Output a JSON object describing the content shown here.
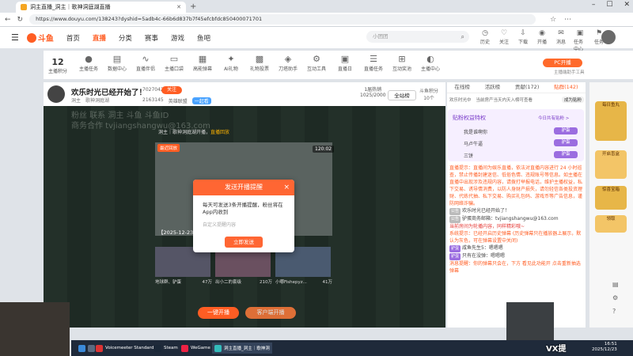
{
  "browser": {
    "tab_title": "洞主直播_洞主｜歌神洞庭湖直播",
    "url": "https://www.douyu.com/138243?dyshid=5adb4c-66b6d837b7f45efcbfdc850400071701"
  },
  "site": {
    "logo_text": "斗鱼",
    "nav": [
      "首页",
      "直播",
      "分类",
      "赛事",
      "游戏",
      "鱼吧"
    ],
    "search_placeholder": "小团团",
    "header_icons": [
      "历史",
      "关注",
      "下载",
      "开播",
      "消息",
      "任务中心",
      "任务"
    ]
  },
  "toolbar": {
    "level_value": "12",
    "level_label": "主播积分",
    "items": [
      "主播任务",
      "数据中心",
      "直播伴侣",
      "主播口袋",
      "高能弹幕",
      "AI礼物",
      "礼物投票",
      "刀塔助手",
      "互动工具",
      "直播日",
      "直播任务",
      "互动奖池",
      "主播中心"
    ],
    "pc_button": "PC开播",
    "pc_sub": "主播端助手工具"
  },
  "room": {
    "title": "欢乐时光已经开始了！",
    "fans": "7027042",
    "follow": "关注",
    "anchor": "洞主",
    "category": "歌神洞庭湖",
    "hot": "2163145",
    "game": "英雄联盟",
    "badge": "一起看",
    "rank_label": "1届热销",
    "rank_value": "1025/2000",
    "all_site": "全站榜",
    "fish_label": "斗鱼积分",
    "fish_value": "10个"
  },
  "video": {
    "watermark_line1": "粉丝 联系 洞主 斗鱼 斗鱼ID",
    "watermark_line2": "商务合作 tvjiangshangwu@163.com",
    "notice_prefix": "洞主｜歌神洞庭湖开播，",
    "notice_highlight": "直播回放",
    "preview_tag": "最近回放",
    "preview_time": "120:02",
    "preview_date": "【2025-12-23 0...",
    "thumbs": [
      {
        "title": "地球群、驴蛋",
        "count": "47万"
      },
      {
        "title": "出小二的套级",
        "count": "210万"
      },
      {
        "title": "小哪Fishepyz...",
        "count": "41万"
      }
    ],
    "open_live": "一键开播",
    "open_live2": "客户端开播"
  },
  "modal": {
    "title": "发送开播提醒",
    "body": "每天可发送3条开播提醒，粉丝将在App内收到",
    "input_placeholder": "自定义提醒内容",
    "button": "立即发送",
    "close": "×"
  },
  "chat": {
    "tabs": [
      "在线榜",
      "活跃榜",
      "贡献(172)",
      "贴群(142)"
    ],
    "info": "欢乐时光中",
    "info_right": "当前房产当天内天入榜可查看",
    "info_btn": "成为贴粉",
    "fan_title": "贴粉权益特权",
    "fan_link": "今日共有贴粉 >",
    "fan_rows": [
      "我是谁啊你",
      "马卢牛逼",
      "三饼"
    ],
    "fan_badges": [
      "驴蛋",
      "驴蛋",
      "驴蛋"
    ],
    "messages": [
      {
        "type": "sys",
        "text": "直播提示：直播间为娱乐直播，依法对直播内容进行 24 小时巡查，禁止传播封建迷信、低俗色情、违规账号等信息。如主播在直播中出现涉及违规内容，请拨打举报电话，维护主播权益，私下交易、诱导情消费，以防人身财产损失，请勿轻信各类投资理财、代练代抽、私下交易、购买礼包码、游戏币等广告信息，谨防网络诈骗。"
      },
      {
        "type": "normal",
        "label": "公告",
        "text": "欢乐时光已经开始了！"
      },
      {
        "type": "normal",
        "label": "公告",
        "text": "驴蛋商务邮箱：tvjiangshangwu@163.com"
      },
      {
        "type": "red",
        "text": "当前房间为轮播内容，同样精彩哦~"
      },
      {
        "type": "sys",
        "text": "系统提示：已经开启历史弹幕 (历史弹幕只在播放器上展示，默认为灰色，可在弹幕设置中关闭)"
      },
      {
        "type": "normal",
        "tag": "驴蛋",
        "text": "咸鱼先生5：嗯嗯嗯"
      },
      {
        "type": "normal",
        "tag": "驴蛋",
        "text": "只有在没弹：嗯嗯嗯"
      },
      {
        "type": "sys",
        "text": "消息提醒：你的弹幕只会在，下方 看见此功能开 点击重新抽选弹幕"
      }
    ]
  },
  "rail": {
    "items": [
      "每日鱼丸",
      "开启盲盒",
      "惊喜宝箱",
      "领取"
    ]
  },
  "overlay": {
    "vx": "VX提"
  },
  "taskbar": {
    "apps": [
      "Voicemeeter Standard",
      "Steam",
      "WeGame",
      "洞主直播_洞主｜歌神洞"
    ],
    "time": "16:51",
    "date": "2025/12/23"
  },
  "colors": {
    "accent": "#ff5d23",
    "purple": "#9b6de0"
  }
}
